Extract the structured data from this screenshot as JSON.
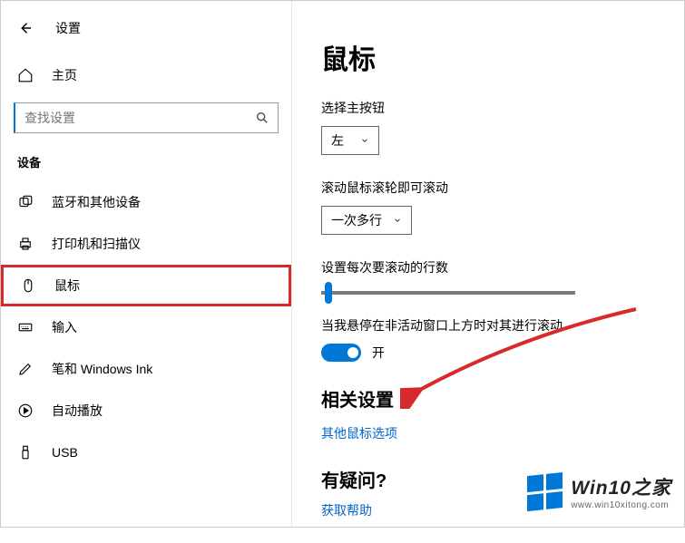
{
  "header": {
    "settings": "设置",
    "home": "主页"
  },
  "search": {
    "placeholder": "查找设置"
  },
  "group_label": "设备",
  "sidebar": {
    "items": [
      {
        "label": "蓝牙和其他设备"
      },
      {
        "label": "打印机和扫描仪"
      },
      {
        "label": "鼠标"
      },
      {
        "label": "输入"
      },
      {
        "label": "笔和 Windows Ink"
      },
      {
        "label": "自动播放"
      },
      {
        "label": "USB"
      }
    ]
  },
  "main": {
    "title": "鼠标",
    "primary_button_label": "选择主按钮",
    "primary_button_value": "左",
    "scroll_label": "滚动鼠标滚轮即可滚动",
    "scroll_value": "一次多行",
    "lines_label": "设置每次要滚动的行数",
    "hover_label": "当我悬停在非活动窗口上方时对其进行滚动",
    "toggle_label": "开",
    "related_head": "相关设置",
    "related_link": "其他鼠标选项",
    "question_head": "有疑问?",
    "help_link": "获取帮助"
  },
  "watermark": {
    "title": "Win10之家",
    "sub": "www.win10xitong.com"
  }
}
